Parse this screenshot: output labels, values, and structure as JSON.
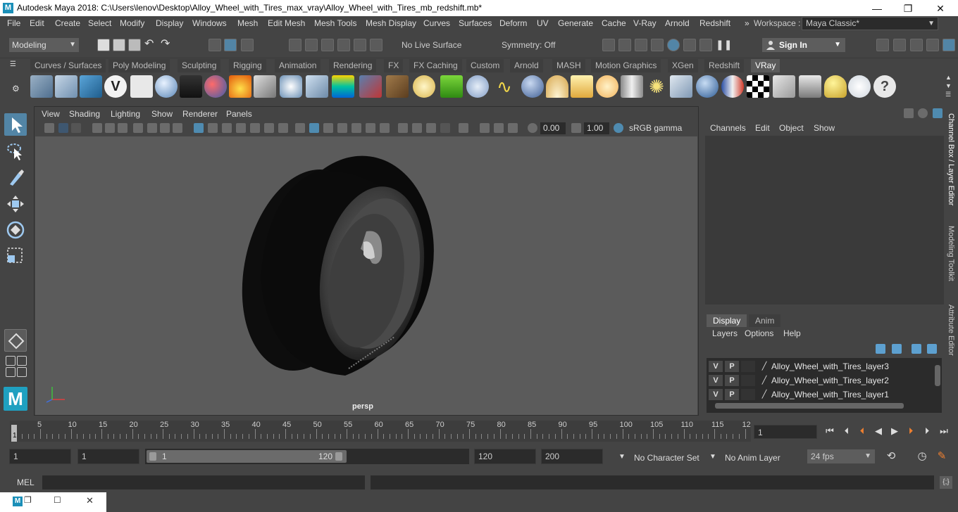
{
  "window": {
    "title": "Autodesk Maya 2018: C:\\Users\\lenov\\Desktop\\Alloy_Wheel_with_Tires_max_vray\\Alloy_Wheel_with_Tires_mb_redshift.mb*",
    "app_icon": "M",
    "controls": {
      "minimize": "—",
      "maximize": "❐",
      "close": "✕"
    }
  },
  "menubar": {
    "items": [
      "File",
      "Edit",
      "Create",
      "Select",
      "Modify",
      "Display",
      "Windows",
      "Mesh",
      "Edit Mesh",
      "Mesh Tools",
      "Mesh Display",
      "Curves",
      "Surfaces",
      "Deform",
      "UV",
      "Generate",
      "Cache",
      "V-Ray",
      "Arnold",
      "Redshift"
    ],
    "overflow": "»",
    "workspace_label": "Workspace :",
    "workspace_value": "Maya Classic*"
  },
  "statusline": {
    "mode": "Modeling",
    "live_surface": "No Live Surface",
    "symmetry": "Symmetry: Off",
    "sign_in": "Sign In"
  },
  "shelf": {
    "tabs": [
      "Curves / Surfaces",
      "Poly Modeling",
      "Sculpting",
      "Rigging",
      "Animation",
      "Rendering",
      "FX",
      "FX Caching",
      "Custom",
      "Arnold",
      "MASH",
      "Motion Graphics",
      "XGen",
      "Redshift",
      "VRay"
    ],
    "active_tab": "VRay",
    "icon_names": [
      "vray-material-icon",
      "vray-lights-icon",
      "vray-render-elements-icon",
      "vray-logo-icon",
      "vray-log-icon",
      "vray-sphere-icon",
      "vray-camera-icon",
      "vray-spheres-icon",
      "vray-fire-icon",
      "vray-plane-icon",
      "vray-box-icon",
      "vray-cone-icon",
      "vray-gradient-icon",
      "vray-fur-icon",
      "vray-texture-icon",
      "vray-dome-icon",
      "vray-grass-icon",
      "vray-ball-icon",
      "vray-curve-icon",
      "vray-mesh-icon",
      "vray-light-dome-icon",
      "vray-spot-icon",
      "vray-sun-icon",
      "vray-cone2-icon",
      "vray-star-icon",
      "vray-rect-light-icon",
      "vray-sphere2-icon",
      "vray-flag-icon",
      "vray-checker-icon",
      "vray-vfb-icon",
      "vray-table-icon",
      "vray-bulb-icon",
      "vray-cloud-icon",
      "help-icon"
    ]
  },
  "viewport": {
    "menus": [
      "View",
      "Shading",
      "Lighting",
      "Show",
      "Renderer",
      "Panels"
    ],
    "exposure": "0.00",
    "gamma": "1.00",
    "color_space": "sRGB gamma",
    "camera": "persp"
  },
  "channel_box": {
    "menus": [
      "Channels",
      "Edit",
      "Object",
      "Show"
    ]
  },
  "layer_editor": {
    "tabs": [
      "Display",
      "Anim"
    ],
    "active_tab": "Display",
    "menus": [
      "Layers",
      "Options",
      "Help"
    ],
    "layers": [
      {
        "v": "V",
        "p": "P",
        "name": "Alloy_Wheel_with_Tires_layer3"
      },
      {
        "v": "V",
        "p": "P",
        "name": "Alloy_Wheel_with_Tires_layer2"
      },
      {
        "v": "V",
        "p": "P",
        "name": "Alloy_Wheel_with_Tires_layer1"
      }
    ]
  },
  "side_tabs": [
    "Channel Box / Layer Editor",
    "Modeling Toolkit",
    "Attribute Editor"
  ],
  "timeslider": {
    "start_tick": "1",
    "ticks": [
      "5",
      "10",
      "15",
      "20",
      "25",
      "30",
      "35",
      "40",
      "45",
      "50",
      "55",
      "60",
      "65",
      "70",
      "75",
      "80",
      "85",
      "90",
      "95",
      "100",
      "105",
      "110",
      "115",
      "12"
    ],
    "current_frame": "1"
  },
  "range": {
    "start": "1",
    "playback_start": "1",
    "range_start": "1",
    "range_end": "120",
    "playback_end": "120",
    "end": "200",
    "character_set": "No Character Set",
    "anim_layer": "No Anim Layer",
    "fps": "24 fps"
  },
  "cmdline": {
    "label": "MEL"
  }
}
